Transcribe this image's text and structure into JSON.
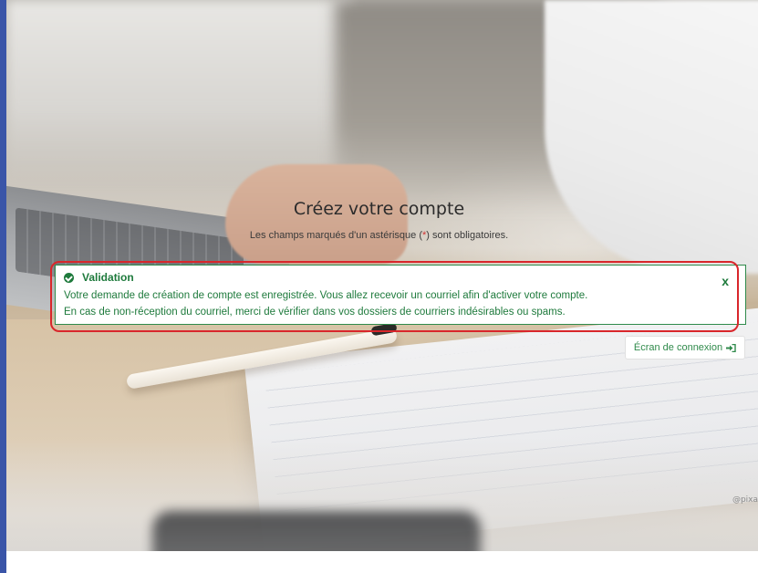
{
  "page": {
    "title": "Créez votre compte",
    "required_note_prefix": "Les champs marqués d'un astérisque (",
    "required_note_star": "*",
    "required_note_suffix": ") sont obligatoires."
  },
  "alert": {
    "title": "Validation",
    "line1": "Votre demande de création de compte est enregistrée. Vous allez recevoir un courriel afin d'activer votre compte.",
    "line2": "En cas de non-réception du courriel, merci de vérifier dans vos dossiers de courriers indésirables ou spams.",
    "close_label": "x",
    "icon": "check-circle-icon",
    "color": "#1e7a3c",
    "highlight_color": "#d9262b"
  },
  "login_link": {
    "label": "Écran de connexion",
    "icon": "sign-in-icon"
  },
  "photo_credit": "@pixa",
  "colors": {
    "accent_bar": "#3a55a8",
    "success": "#1e7a3c",
    "required_star": "#d23535"
  }
}
